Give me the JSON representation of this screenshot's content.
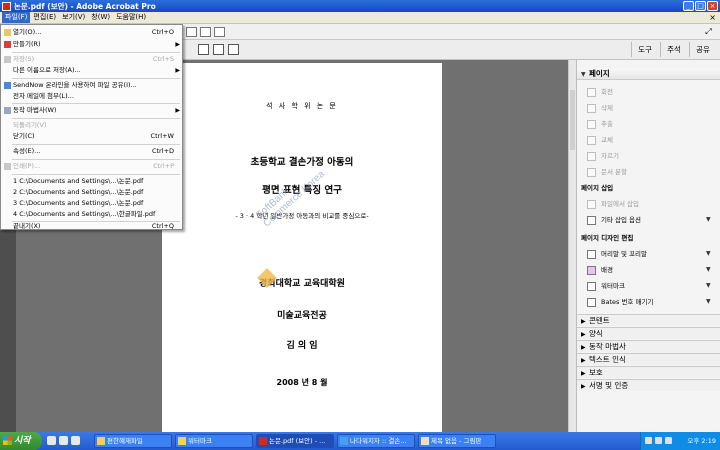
{
  "window": {
    "title": "논문.pdf (보안) - Adobe Acrobat Pro"
  },
  "menubar": {
    "items": [
      "파일(F)",
      "편집(E)",
      "보기(V)",
      "창(W)",
      "도움말(H)"
    ],
    "close_glyph": "×"
  },
  "toolbar": {
    "tabs": [
      "도구",
      "주석",
      "공유"
    ],
    "expand_glyph": "⤢"
  },
  "file_menu": {
    "items": [
      {
        "label": "열기(O)...",
        "shortcut": "Ctrl+O",
        "disabled": false,
        "submenu": false
      },
      {
        "label": "만들기(R)",
        "shortcut": "",
        "disabled": false,
        "submenu": true
      },
      {
        "label": "저장(S)",
        "shortcut": "Ctrl+S",
        "disabled": true,
        "submenu": false
      },
      {
        "label": "다른 이름으로 저장(A)...",
        "shortcut": "",
        "disabled": false,
        "submenu": true
      },
      {
        "label": "SendNow 온라인을 사용하여 파일 공유(I)...",
        "shortcut": "",
        "disabled": false,
        "submenu": false
      },
      {
        "label": "전자 메일에 첨부(L)...",
        "shortcut": "",
        "disabled": false,
        "submenu": false
      },
      {
        "label": "동작 마법사(W)",
        "shortcut": "",
        "disabled": false,
        "submenu": true
      },
      {
        "label": "되돌리기(V)",
        "shortcut": "",
        "disabled": true,
        "submenu": false
      },
      {
        "label": "닫기(C)",
        "shortcut": "Ctrl+W",
        "disabled": false,
        "submenu": false
      },
      {
        "label": "속성(E)...",
        "shortcut": "Ctrl+D",
        "disabled": false,
        "submenu": false
      },
      {
        "label": "인쇄(P)...",
        "shortcut": "Ctrl+P",
        "disabled": true,
        "submenu": false
      },
      {
        "label": "1 C:\\Documents and Settings\\...\\논문.pdf",
        "shortcut": "",
        "disabled": false,
        "submenu": false
      },
      {
        "label": "2 C:\\Documents and Settings\\...\\논문.pdf",
        "shortcut": "",
        "disabled": false,
        "submenu": false
      },
      {
        "label": "3 C:\\Documents and Settings\\...\\논문.pdf",
        "shortcut": "",
        "disabled": false,
        "submenu": false
      },
      {
        "label": "4 C:\\Documents and Settings\\...\\한글파일.pdf",
        "shortcut": "",
        "disabled": false,
        "submenu": false
      },
      {
        "label": "끝내기(X)",
        "shortcut": "Ctrl+Q",
        "disabled": false,
        "submenu": false
      }
    ]
  },
  "document": {
    "degree": "석 사 학 위 논 문",
    "title_line1": "초등학교 결손가정 아동의",
    "title_line2": "평면 표현 특징 연구",
    "subtitle": "- 3 · 4 학년 일반가정 아동과의 비교를 중심으로-",
    "institution": "경희대학교 교육대학원",
    "major": "미술교육전공",
    "author": "김 의 임",
    "date": "2008 년 8 월",
    "watermark_line1": "SoftBank",
    "watermark_line2": "Commerce Korea"
  },
  "panel": {
    "pages_header": "페이지",
    "page_tools": [
      "회전",
      "삭제",
      "추출",
      "교체",
      "자르기",
      "문서 분할"
    ],
    "insert_header": "페이지 삽입",
    "insert_items": [
      "파일에서 삽입",
      "기타 삽입 옵션"
    ],
    "design_header": "페이지 디자인 편집",
    "design_items": [
      "머리말 및 꼬리말",
      "배경",
      "워터마크",
      "Bates 번호 매기기"
    ],
    "collapsed_sections": [
      "콘텐트",
      "양식",
      "동작 마법사",
      "텍스트 인식",
      "보호",
      "서명 및 인증"
    ]
  },
  "taskbar": {
    "start_label": "시작",
    "tasks": [
      "편한혜재파일",
      "워터마크",
      "논문.pdf (보안) - ...",
      "나다워지자 :: 결손...",
      "제목 없음 - 그림판"
    ],
    "clock": "오후 2:19"
  },
  "colors": {
    "titlebar": "#1f57d4",
    "menu_highlight": "#316ac5",
    "taskbar": "#245ad0",
    "start": "#338a2e"
  }
}
